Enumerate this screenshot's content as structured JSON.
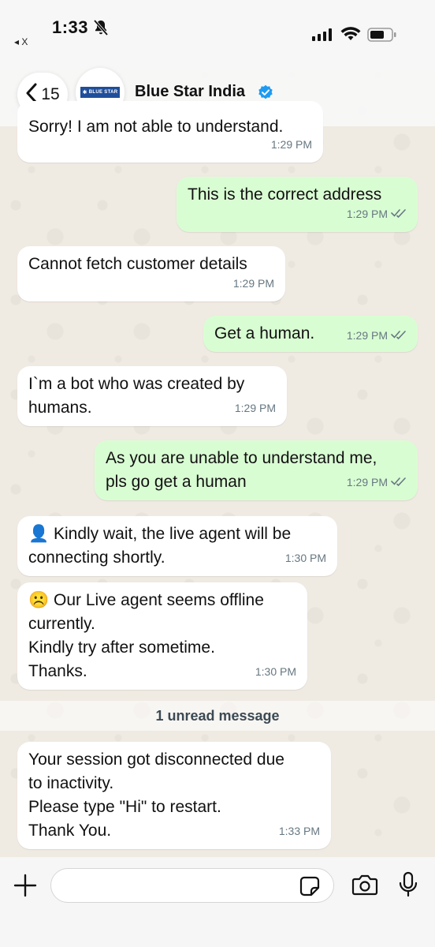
{
  "status_bar": {
    "time": "1:33",
    "back_app": "◂ X"
  },
  "header": {
    "back_count": "15",
    "contact_name": "Blue Star India",
    "logo_text": "BLUE STAR"
  },
  "messages": [
    {
      "dir": "in",
      "text": "Sorry! I am not able to understand.",
      "time": "1:29 PM"
    },
    {
      "dir": "out",
      "text": "This is the correct address",
      "time": "1:29 PM"
    },
    {
      "dir": "in",
      "text": "Cannot fetch customer details",
      "time": "1:29 PM"
    },
    {
      "dir": "out",
      "text": "Get a human.",
      "time": "1:29 PM"
    },
    {
      "dir": "in",
      "text": "I`m a bot who was created by\nhumans.",
      "time": "1:29 PM"
    },
    {
      "dir": "out",
      "text": "As you are unable to understand me,\npls go get a human",
      "time": "1:29 PM"
    },
    {
      "dir": "in",
      "text": "👤 Kindly wait, the live agent will be\nconnecting shortly.",
      "time": "1:30 PM"
    },
    {
      "dir": "in",
      "text": "☹️ Our Live agent seems offline\ncurrently.\nKindly try after sometime.\nThanks.",
      "time": "1:30 PM"
    },
    {
      "dir": "in",
      "text": "Your session got disconnected due\nto inactivity.\nPlease type \"Hi\" to restart.\nThank You.",
      "time": "1:33 PM"
    }
  ],
  "unread_banner": "1 unread message",
  "composer": {
    "placeholder": ""
  },
  "colors": {
    "outgoing": "#d9fdd3",
    "incoming": "#ffffff",
    "read_tick": "#53bdeb",
    "verified": "#1d9bf0"
  }
}
